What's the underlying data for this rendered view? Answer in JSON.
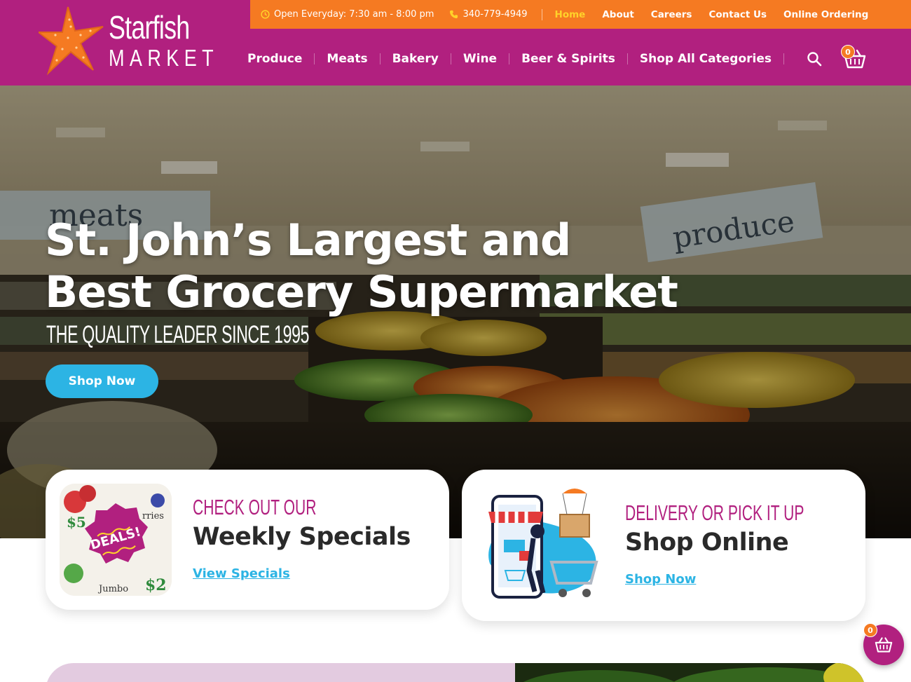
{
  "brand": {
    "name_line1": "Starfish",
    "name_line2": "MARKET"
  },
  "topbar": {
    "hours": "Open Everyday: 7:30 am - 8:00 pm",
    "phone": "340-779-4949",
    "links": [
      "Home",
      "About",
      "Careers",
      "Contact Us",
      "Online Ordering"
    ],
    "active": "Home"
  },
  "nav": {
    "items": [
      "Produce",
      "Meats",
      "Bakery",
      "Wine",
      "Beer & Spirits",
      "Shop All Categories"
    ],
    "cart_count": "0"
  },
  "hero": {
    "title_line1": "St. John’s Largest and",
    "title_line2": "Best Grocery Supermarket",
    "subtitle": "THE QUALITY LEADER SINCE 1995",
    "button": "Shop Now",
    "sign_left": "meats",
    "sign_right": "produce"
  },
  "cards": [
    {
      "kicker": "CHECK OUT OUR",
      "title": "Weekly Specials",
      "link": "View Specials",
      "image_badge": "DEALS!"
    },
    {
      "kicker": "DELIVERY OR PICK IT UP",
      "title": "Shop Online",
      "link": "Shop Now"
    }
  ],
  "floating_cart": {
    "count": "0"
  },
  "colors": {
    "magenta": "#b1207f",
    "orange": "#f57a22",
    "sky": "#2cb4e4",
    "yellow": "#ffd22a"
  },
  "icons": [
    "clock-icon",
    "phone-icon",
    "search-icon",
    "basket-icon",
    "starfish-icon"
  ]
}
